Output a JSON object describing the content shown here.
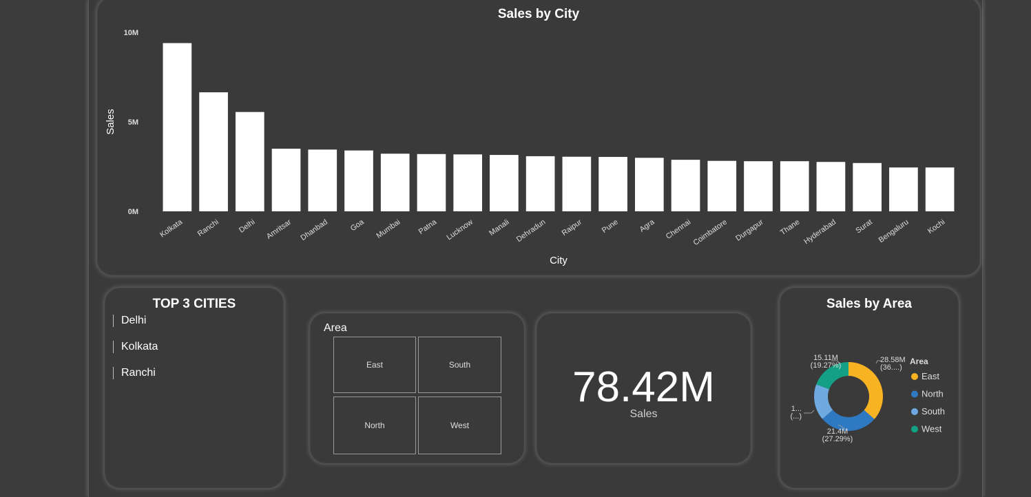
{
  "sales_by_city": {
    "title": "Sales by City",
    "xlabel": "City",
    "ylabel": "Sales"
  },
  "top3": {
    "title": "TOP 3 CITIES",
    "items": [
      "Delhi",
      "Kolkata",
      "Ranchi"
    ]
  },
  "area_slicer": {
    "title": "Area",
    "tiles": [
      "East",
      "South",
      "North",
      "West"
    ]
  },
  "kpi": {
    "value": "78.42M",
    "label": "Sales"
  },
  "sales_by_area": {
    "title": "Sales by Area",
    "legend_title": "Area"
  },
  "chart_data": [
    {
      "type": "bar",
      "title": "Sales by City",
      "xlabel": "City",
      "ylabel": "Sales",
      "categories": [
        "Kolkata",
        "Ranchi",
        "Delhi",
        "Amritsar",
        "Dhanbad",
        "Goa",
        "Mumbai",
        "Patna",
        "Lucknow",
        "Manali",
        "Dehradun",
        "Raipur",
        "Pune",
        "Agra",
        "Chennai",
        "Coimbatore",
        "Durgapur",
        "Thane",
        "Hyderabad",
        "Surat",
        "Bengaluru",
        "Kochi"
      ],
      "values": [
        9.4,
        6.65,
        5.55,
        3.5,
        3.45,
        3.4,
        3.22,
        3.2,
        3.18,
        3.15,
        3.08,
        3.05,
        3.04,
        2.99,
        2.88,
        2.82,
        2.8,
        2.8,
        2.76,
        2.7,
        2.45,
        2.45
      ],
      "unit": "M",
      "yticks": [
        "0M",
        "5M",
        "10M"
      ],
      "ylim": [
        0,
        10
      ],
      "grid": false,
      "colors": {
        "bar": "#ffffff",
        "text": "#dddddd"
      }
    },
    {
      "type": "pie",
      "title": "Sales by Area",
      "donut": true,
      "legend_title": "Area",
      "legend_position": "right",
      "slices": [
        {
          "name": "East",
          "value": 28.58,
          "label": "28.58M",
          "pct_label": "(36....)",
          "color": "#f8b322"
        },
        {
          "name": "North",
          "value": 21.4,
          "label": "21.4M",
          "pct_label": "(27.29%)",
          "color": "#2f78c2"
        },
        {
          "name": "South",
          "value": 13.33,
          "label": "1...",
          "pct_label": "(...)",
          "color": "#6ea9e0"
        },
        {
          "name": "West",
          "value": 15.11,
          "label": "15.11M",
          "pct_label": "(19.27%)",
          "color": "#14a085"
        }
      ]
    }
  ]
}
